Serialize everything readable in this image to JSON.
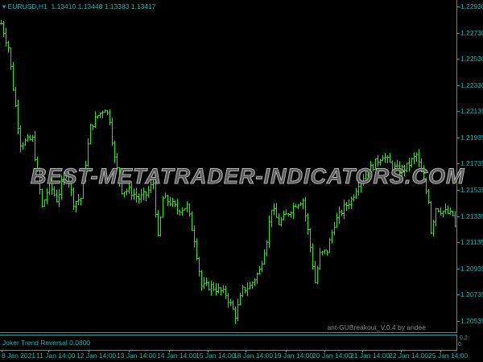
{
  "header": {
    "symbol": "EURUSD,H1",
    "ohlc": "1.13410 1.13448 1.13383 1.13417"
  },
  "watermark": "BEST-METATRADER-INDICATORS.COM",
  "credit": "ant-GUBreakout_V.0.4 by andee",
  "indicator": {
    "label": "Joker Trend Reversal 0.0800",
    "scale_top": "0.2",
    "scale_bottom": "0"
  },
  "colors": {
    "bars": "#33dd22",
    "axis": "#1fa8a8",
    "background": "#000000"
  },
  "chart_data": {
    "type": "ohlc",
    "price_labels": [
      "1.22930",
      "1.22730",
      "1.22530",
      "1.22330",
      "1.22135",
      "1.21935",
      "1.21735",
      "1.21535",
      "1.21335",
      "1.21135",
      "1.20935",
      "1.20735",
      "1.20535"
    ],
    "time_labels": [
      "8 Jan 2021",
      "11 Jan 14:00",
      "12 Jan 14:00",
      "13 Jan 14:00",
      "14 Jan 14:00",
      "15 Jan 14:00",
      "18 Jan 14:00",
      "19 Jan 14:00",
      "20 Jan 14:00",
      "21 Jan 14:00",
      "22 Jan 14:00",
      "25 Jan 14:00"
    ],
    "ylim": [
      1.2045,
      1.2298
    ],
    "bars_count": 189,
    "close_waypoints": [
      [
        0,
        1.228
      ],
      [
        3,
        1.2262
      ],
      [
        5,
        1.2231
      ],
      [
        8,
        1.2189
      ],
      [
        13,
        1.2192
      ],
      [
        17,
        1.214
      ],
      [
        20,
        1.2158
      ],
      [
        23,
        1.2146
      ],
      [
        27,
        1.2168
      ],
      [
        30,
        1.2144
      ],
      [
        33,
        1.2147
      ],
      [
        37,
        1.2201
      ],
      [
        40,
        1.221
      ],
      [
        43,
        1.2216
      ],
      [
        45,
        1.2207
      ],
      [
        47,
        1.2177
      ],
      [
        50,
        1.2153
      ],
      [
        53,
        1.2153
      ],
      [
        57,
        1.2147
      ],
      [
        60,
        1.215
      ],
      [
        63,
        1.2159
      ],
      [
        65,
        1.2116
      ],
      [
        67,
        1.2147
      ],
      [
        70,
        1.2144
      ],
      [
        73,
        1.2138
      ],
      [
        77,
        1.2141
      ],
      [
        80,
        1.2116
      ],
      [
        83,
        1.208
      ],
      [
        87,
        1.208
      ],
      [
        90,
        1.2077
      ],
      [
        93,
        1.2074
      ],
      [
        97,
        1.2058
      ],
      [
        100,
        1.2077
      ],
      [
        103,
        1.208
      ],
      [
        107,
        1.2092
      ],
      [
        110,
        1.2116
      ],
      [
        112,
        1.214
      ],
      [
        115,
        1.2128
      ],
      [
        118,
        1.2134
      ],
      [
        122,
        1.2143
      ],
      [
        125,
        1.2146
      ],
      [
        128,
        1.211
      ],
      [
        130,
        1.2083
      ],
      [
        132,
        1.2104
      ],
      [
        135,
        1.2107
      ],
      [
        138,
        1.2128
      ],
      [
        142,
        1.214
      ],
      [
        145,
        1.2146
      ],
      [
        148,
        1.2159
      ],
      [
        152,
        1.2168
      ],
      [
        155,
        1.2174
      ],
      [
        158,
        1.218
      ],
      [
        162,
        1.2171
      ],
      [
        165,
        1.2168
      ],
      [
        168,
        1.2171
      ],
      [
        172,
        1.218
      ],
      [
        175,
        1.2159
      ],
      [
        177,
        1.2146
      ],
      [
        178,
        1.2122
      ],
      [
        180,
        1.214
      ],
      [
        183,
        1.2137
      ],
      [
        187,
        1.2134
      ],
      [
        189,
        1.2116
      ]
    ]
  }
}
